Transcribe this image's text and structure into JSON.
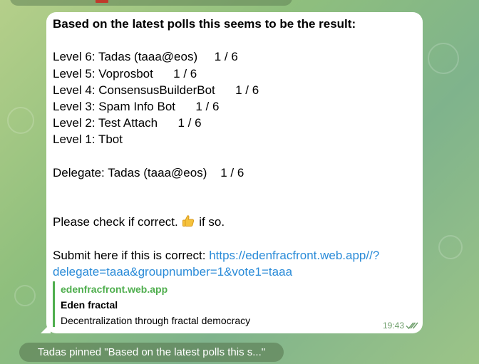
{
  "message": {
    "heading": "Based on the latest polls this seems to be the result:",
    "levels": [
      "Level 6: Tadas (taaa@eos)     1 / 6",
      "Level 5: Voprosbot      1 / 6",
      "Level 4: ConsensusBuilderBot      1 / 6",
      "Level 3: Spam Info Bot      1 / 6",
      "Level 2: Test Attach      1 / 6",
      "Level 1: Tbot"
    ],
    "delegate": "Delegate: Tadas (taaa@eos)    1 / 6",
    "check_prefix": "Please check if correct. ",
    "check_suffix": " if so.",
    "check_icon": "thumbs-up-icon",
    "submit_prefix": "Submit here if this is correct: ",
    "link_part1": "https://edenfracfront.web.app//?",
    "link_part2": "delegate=taaa&groupnumber=1&vote1=taaa",
    "time": "19:43",
    "status_icon": "double-check-icon"
  },
  "preview": {
    "site": "edenfracfront.web.app",
    "title": "Eden fractal",
    "description": "Decentralization through fractal democracy"
  },
  "service": {
    "pinned_text": "Tadas pinned \"Based on the latest polls this s...\""
  },
  "colors": {
    "link": "#2a8bd8",
    "accent_green": "#4fae4e",
    "bubble": "#ffffff"
  }
}
